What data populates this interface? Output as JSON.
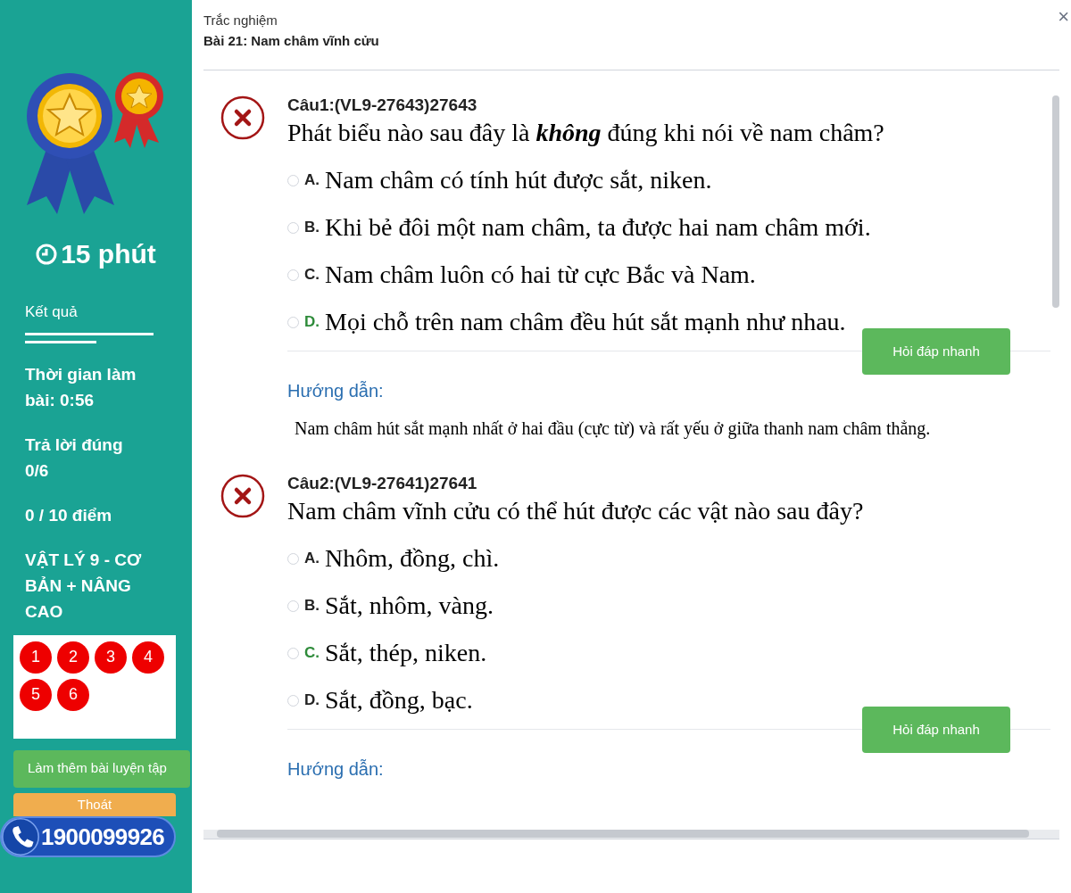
{
  "sidebar": {
    "duration": "15 phút",
    "result_heading": "Kết quả",
    "stats": [
      "Thời gian làm bài: 0:56",
      "Trả lời đúng 0/6",
      "0 / 10 điểm",
      "VẬT LÝ 9 - CƠ BẢN + NÂNG CAO"
    ],
    "question_numbers": [
      {
        "label": "1",
        "correct": false
      },
      {
        "label": "2",
        "correct": false
      },
      {
        "label": "3",
        "correct": false
      },
      {
        "label": "4",
        "correct": false
      },
      {
        "label": "5",
        "correct": false
      },
      {
        "label": "6",
        "correct": false
      }
    ],
    "practice_button": "Làm thêm bài luyện tập",
    "exit_button": "Thoát",
    "hotline": "1900099926"
  },
  "header": {
    "subtitle": "Trắc nghiệm",
    "title": "Bài 21: Nam châm vĩnh cửu",
    "close": "×"
  },
  "questions": [
    {
      "code": "Câu1:(VL9-27643)27643",
      "correct": false,
      "text": "Phát biểu nào sau đây là **không** đúng khi nói về nam châm?",
      "options": [
        {
          "letter": "A.",
          "text": "Nam châm có tính hút được sắt, niken.",
          "correct": false,
          "selected": false
        },
        {
          "letter": "B.",
          "text": "Khi bẻ đôi một nam châm, ta được hai nam châm mới.",
          "correct": false,
          "selected": false
        },
        {
          "letter": "C.",
          "text": "Nam châm luôn có hai từ cực Bắc và Nam.",
          "correct": false,
          "selected": false
        },
        {
          "letter": "D.",
          "text": "Mọi chỗ trên nam châm đều hút sắt mạnh như nhau.",
          "correct": true,
          "selected": false
        }
      ],
      "ask_button": "Hỏi đáp nhanh",
      "guide_label": "Hướng dẫn:",
      "guide_text": "Nam châm hút sắt mạnh nhất ở hai đầu (cực từ) và rất yếu ở giữa thanh nam châm thẳng."
    },
    {
      "code": "Câu2:(VL9-27641)27641",
      "correct": false,
      "text": "Nam châm vĩnh cửu có thể hút được các vật nào sau đây?",
      "options": [
        {
          "letter": "A.",
          "text": "Nhôm, đồng, chì.",
          "correct": false,
          "selected": false
        },
        {
          "letter": "B.",
          "text": "Sắt, nhôm, vàng.",
          "correct": false,
          "selected": false
        },
        {
          "letter": "C.",
          "text": "Sắt, thép, niken.",
          "correct": true,
          "selected": false
        },
        {
          "letter": "D.",
          "text": "Sắt, đồng, bạc.",
          "correct": false,
          "selected": false
        }
      ],
      "ask_button": "Hỏi đáp nhanh",
      "guide_label": "Hướng dẫn:"
    }
  ]
}
